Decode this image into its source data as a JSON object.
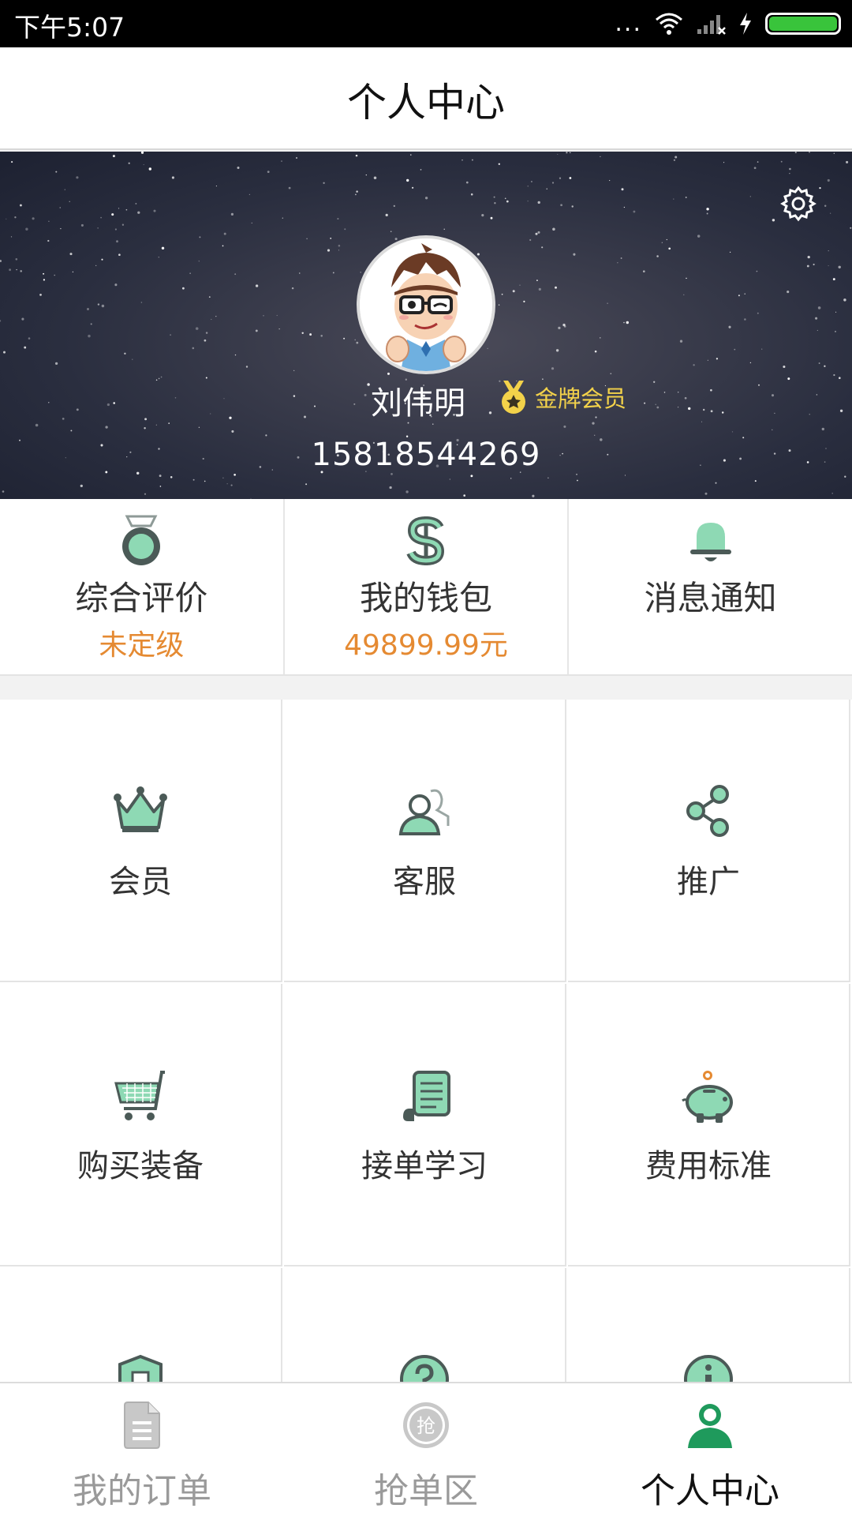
{
  "status_bar": {
    "time": "下午5:07",
    "dots": "...",
    "accent": "#39c43b"
  },
  "header": {
    "title": "个人中心"
  },
  "profile": {
    "name": "刘伟明",
    "member_level": "金牌会员",
    "phone": "15818544269"
  },
  "stats": [
    {
      "label": "综合评价",
      "value": "未定级",
      "icon": "medal-icon"
    },
    {
      "label": "我的钱包",
      "value": "49899.99元",
      "icon": "dollar-icon"
    },
    {
      "label": "消息通知",
      "value": "",
      "icon": "bell-icon"
    }
  ],
  "grid": [
    {
      "label": "会员",
      "icon": "crown-icon"
    },
    {
      "label": "客服",
      "icon": "customer-service-icon"
    },
    {
      "label": "推广",
      "icon": "share-icon"
    },
    {
      "label": "购买装备",
      "icon": "shopping-cart-icon"
    },
    {
      "label": "接单学习",
      "icon": "scroll-icon"
    },
    {
      "label": "费用标准",
      "icon": "piggy-bank-icon"
    },
    {
      "label": "",
      "icon": "shield-icon"
    },
    {
      "label": "",
      "icon": "help-icon"
    },
    {
      "label": "",
      "icon": "info-icon"
    }
  ],
  "tabbar": {
    "items": [
      {
        "label": "我的订单",
        "icon": "order-document-icon",
        "active": false
      },
      {
        "label": "抢单区",
        "icon": "grab-order-icon",
        "active": false,
        "icon_text": "抢"
      },
      {
        "label": "个人中心",
        "icon": "person-icon",
        "active": true
      }
    ]
  },
  "colors": {
    "primary_green": "#2fa66a",
    "icon_mint": "#8ed9b4",
    "icon_dark": "#4b5a57",
    "orange": "#e58a32",
    "gold": "#f3d24a"
  }
}
